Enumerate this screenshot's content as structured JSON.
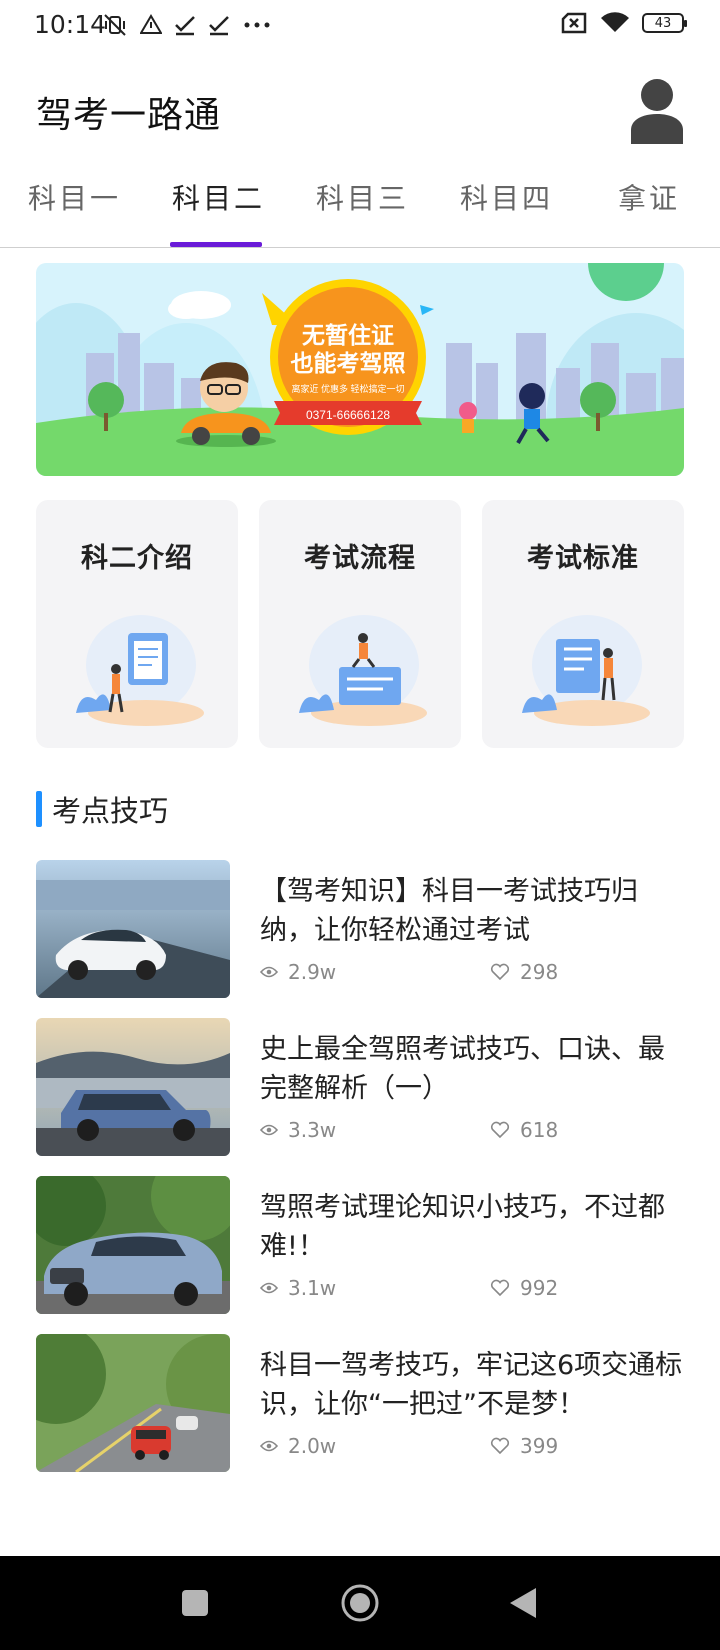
{
  "status_bar": {
    "time": "10:14",
    "battery": "43",
    "left_icons": [
      "mute-vibrate-icon",
      "warning-icon",
      "check-icon",
      "check-icon",
      "more-dots-icon"
    ],
    "right_icons": [
      "no-sim-icon",
      "wifi-icon",
      "battery-icon"
    ]
  },
  "app_bar": {
    "title": "驾考一路通"
  },
  "tabs": [
    {
      "label": "科目一",
      "active": false
    },
    {
      "label": "科目二",
      "active": true
    },
    {
      "label": "科目三",
      "active": false
    },
    {
      "label": "科目四",
      "active": false
    },
    {
      "label": "拿证",
      "active": false
    }
  ],
  "banner": {
    "headline_1": "无暂住证",
    "headline_2": "也能考驾照",
    "tagline": "离家近  优惠多  轻松搞定一切",
    "phone": "0371-66666128"
  },
  "cards": [
    {
      "title": "科二介绍"
    },
    {
      "title": "考试流程"
    },
    {
      "title": "考试标准"
    }
  ],
  "section": {
    "title": "考点技巧"
  },
  "articles": [
    {
      "title": "【驾考知识】科目一考试技巧归纳，让你轻松通过考试",
      "views": "2.9w",
      "likes": "298"
    },
    {
      "title": "史上最全驾照考试技巧、口诀、最完整解析（一）",
      "views": "3.3w",
      "likes": "618"
    },
    {
      "title": "驾照考试理论知识小技巧，不过都难!！",
      "views": "3.1w",
      "likes": "992"
    },
    {
      "title": "科目一驾考技巧，牢记这6项交通标识，让你“一把过”不是梦！",
      "views": "2.0w",
      "likes": "399"
    }
  ],
  "colors": {
    "accent_tab": "#6a1bd8",
    "section_bar": "#1e90ff",
    "card_bg": "#f4f4f6",
    "banner_orange": "#f7941d",
    "banner_yellow": "#ffd400",
    "banner_red": "#e53b2c",
    "banner_sky": "#cdeffb",
    "banner_grass": "#6fd46a"
  }
}
